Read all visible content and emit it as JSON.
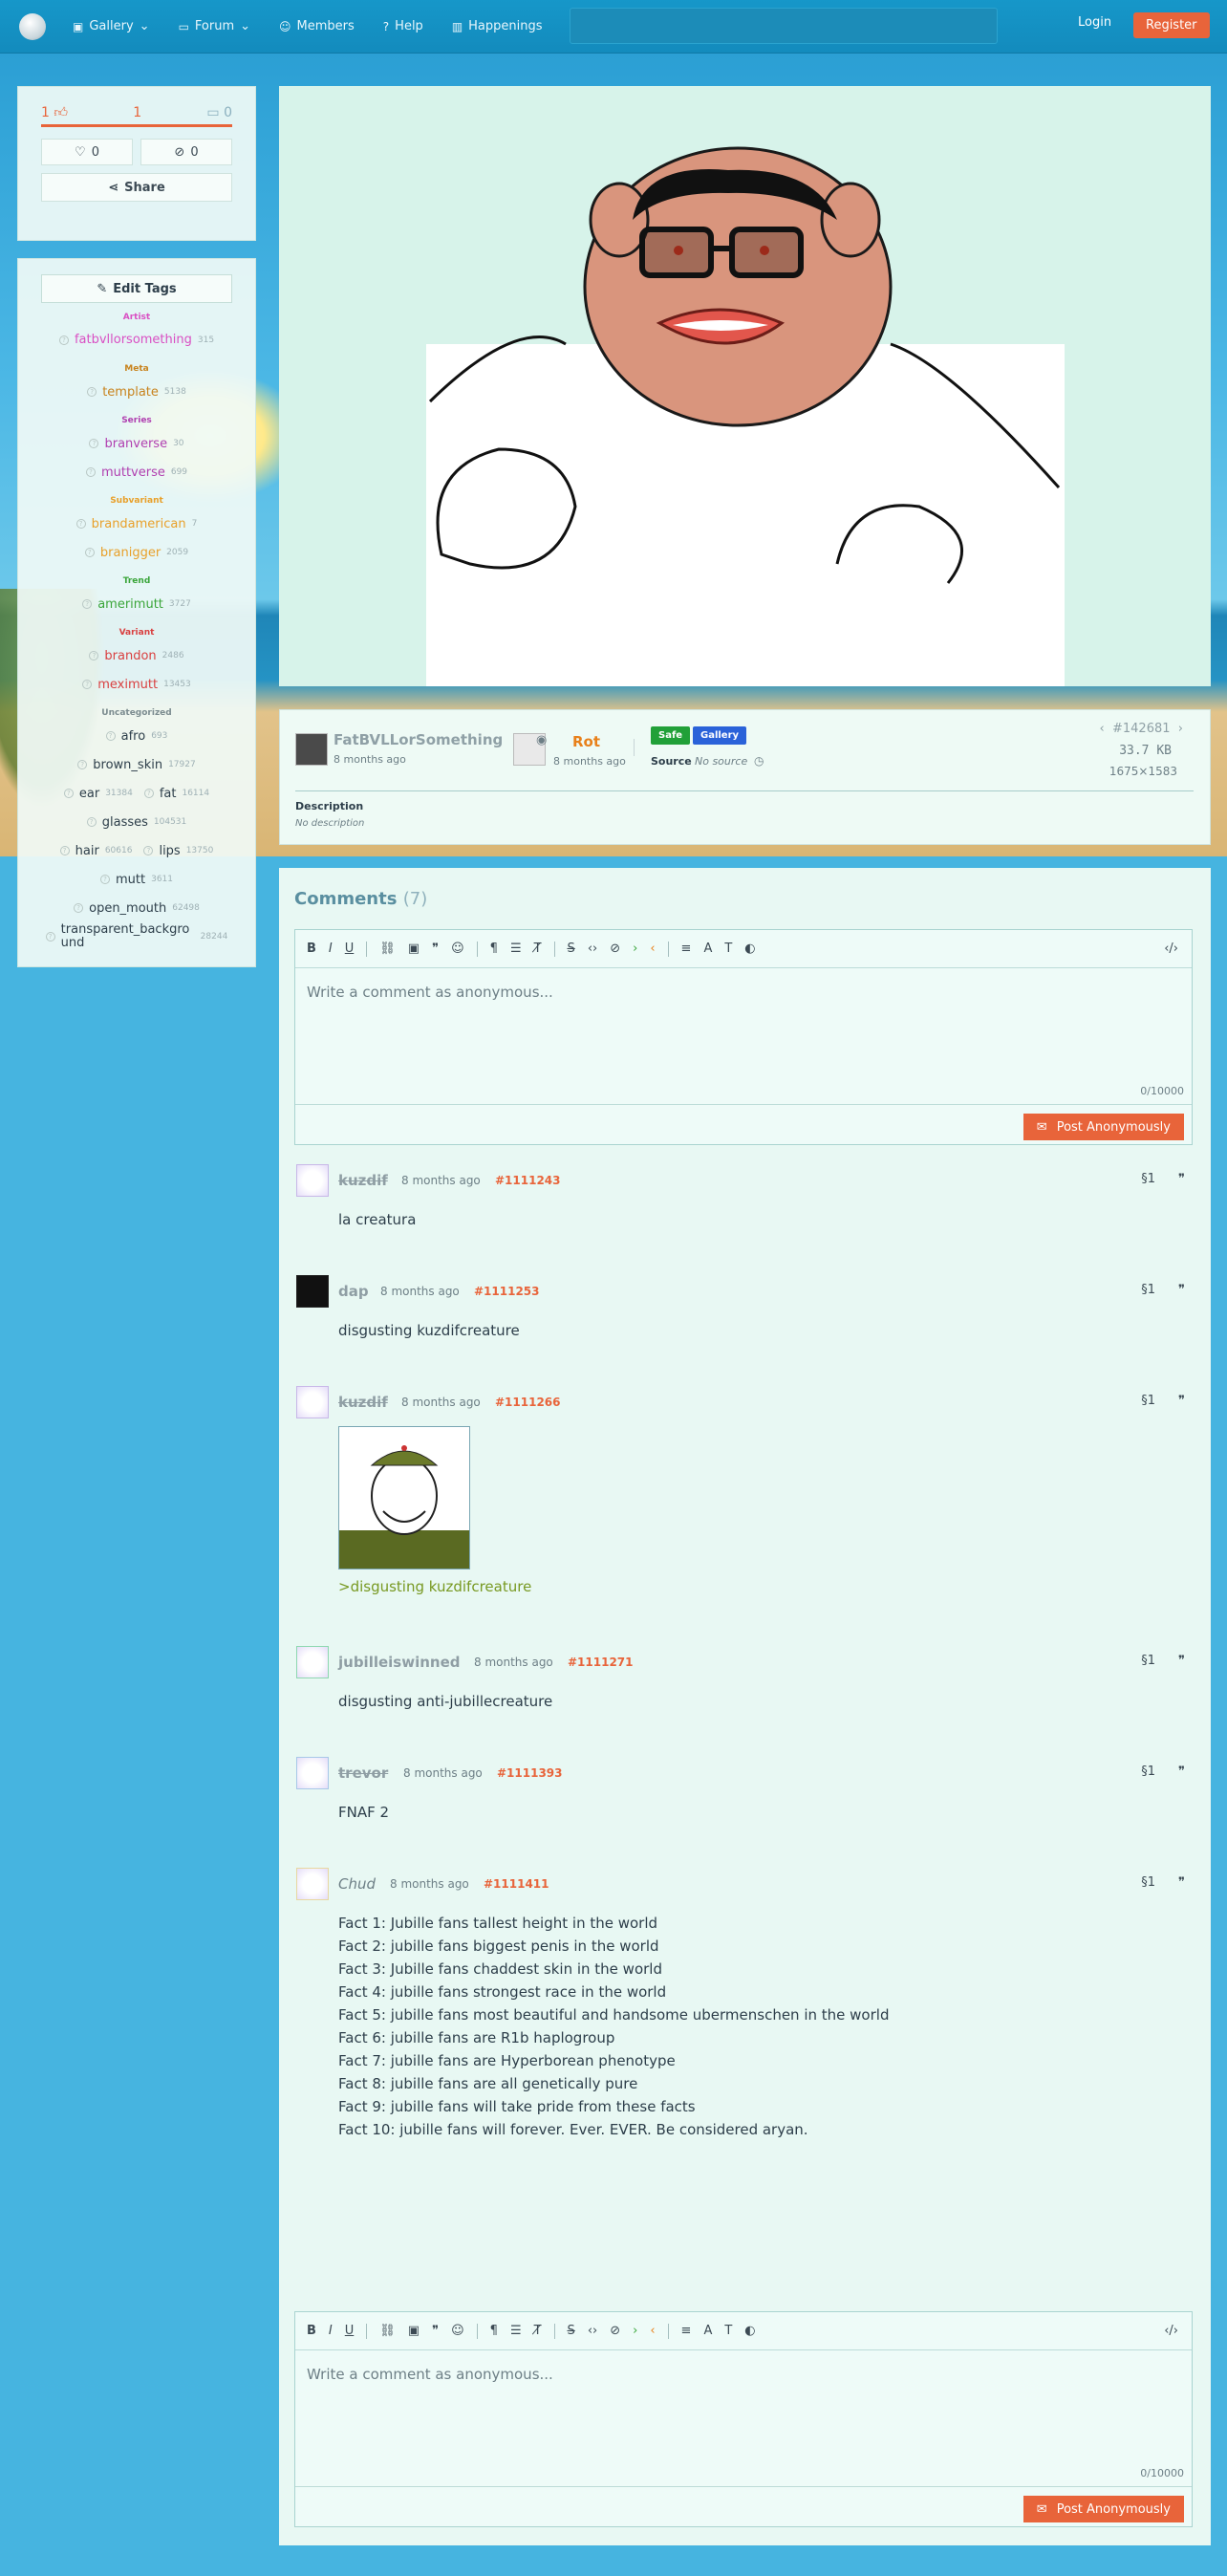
{
  "nav": {
    "items": [
      "Gallery",
      "Forum",
      "Members",
      "Help",
      "Happenings"
    ],
    "login": "Login",
    "register": "Register"
  },
  "votes": {
    "up": "1",
    "score": "1",
    "down": "0",
    "favorites": "0",
    "hides": "0",
    "share": "Share"
  },
  "tags": {
    "edit_label": "Edit Tags",
    "categories": [
      {
        "name": "Artist",
        "color": "#d94fc3",
        "rows": [
          [
            {
              "name": "fatbvllorsomething",
              "count": "315"
            }
          ]
        ]
      },
      {
        "name": "Meta",
        "color": "#c8831e",
        "rows": [
          [
            {
              "name": "template",
              "count": "5138"
            }
          ]
        ]
      },
      {
        "name": "Series",
        "color": "#b040b0",
        "rows": [
          [
            {
              "name": "branverse",
              "count": "30"
            }
          ],
          [
            {
              "name": "muttverse",
              "count": "699"
            }
          ]
        ]
      },
      {
        "name": "Subvariant",
        "color": "#e8a02a",
        "rows": [
          [
            {
              "name": "brandamerican",
              "count": "7"
            }
          ],
          [
            {
              "name": "branigger",
              "count": "2059"
            }
          ]
        ]
      },
      {
        "name": "Trend",
        "color": "#3aa53a",
        "rows": [
          [
            {
              "name": "amerimutt",
              "count": "3727"
            }
          ]
        ]
      },
      {
        "name": "Variant",
        "color": "#d94040",
        "rows": [
          [
            {
              "name": "brandon",
              "count": "2486"
            }
          ],
          [
            {
              "name": "meximutt",
              "count": "13453"
            }
          ]
        ]
      },
      {
        "name": "Uncategorized",
        "color": "#7c8c90",
        "rows": [
          [
            {
              "name": "afro",
              "count": "693"
            }
          ],
          [
            {
              "name": "brown_skin",
              "count": "17927"
            }
          ],
          [
            {
              "name": "ear",
              "count": "31384"
            },
            {
              "name": "fat",
              "count": "16114"
            }
          ],
          [
            {
              "name": "glasses",
              "count": "104531"
            }
          ],
          [
            {
              "name": "hair",
              "count": "60616"
            },
            {
              "name": "lips",
              "count": "13750"
            }
          ],
          [
            {
              "name": "mutt",
              "count": "3611"
            }
          ],
          [
            {
              "name": "open_mouth",
              "count": "62498"
            }
          ],
          [
            {
              "name": "transparent_background",
              "count": "28244"
            }
          ]
        ]
      }
    ]
  },
  "meta": {
    "uploader": "FatBVLLorSomething",
    "uploader_time": "8 months ago",
    "approver": "Rot",
    "approver_time": "8 months ago",
    "rating_badge": "Safe",
    "gallery_badge": "Gallery",
    "source_label": "Source",
    "source_value": "No source",
    "post_id": "#142681",
    "file_size": "33.7 KB",
    "dimensions": "1675×1583",
    "description_label": "Description",
    "description_value": "No description"
  },
  "comments": {
    "title": "Comments",
    "count": "(7)",
    "editor_placeholder": "Write a comment as anonymous...",
    "char_count": "0/10000",
    "post_button": "Post Anonymously",
    "list": [
      {
        "user": "kuzdif",
        "time": "8 months ago",
        "id": "#1111243",
        "body": [
          "la creatura"
        ]
      },
      {
        "user": "dap",
        "time": "8 months ago",
        "id": "#1111253",
        "body": [
          "disgusting kuzdifcreature"
        ]
      },
      {
        "user": "kuzdif",
        "time": "8 months ago",
        "id": "#1111266",
        "body": [
          ">disgusting kuzdifcreature"
        ]
      },
      {
        "user": "jubilleiswinned",
        "time": "8 months ago",
        "id": "#1111271",
        "body": [
          "disgusting anti-jubillecreature"
        ]
      },
      {
        "user": "trevor",
        "time": "8 months ago",
        "id": "#1111393",
        "body": [
          "FNAF 2"
        ]
      },
      {
        "user": "Chud",
        "time": "8 months ago",
        "id": "#1111411",
        "body": [
          "Fact 1: Jubille fans tallest height in the world",
          "Fact 2: jubille fans biggest penis in the world",
          "Fact 3: Jubille fans chaddest skin in the world",
          "Fact 4: jubille fans strongest race in the world",
          "Fact 5: jubille fans most beautiful and handsome ubermenschen in the world",
          "Fact 6: jubille fans are R1b haplogroup",
          "Fact 7: jubille fans are Hyperborean phenotype",
          "Fact 8: jubille fans are all genetically pure",
          "Fact 9: jubille fans will take pride from these facts",
          "Fact 10: jubille fans will forever. Ever. EVER. Be considered aryan."
        ]
      }
    ]
  },
  "colors": {
    "accent": "#e8643a",
    "safe": "#21a038",
    "gallery": "#2a62d9"
  }
}
